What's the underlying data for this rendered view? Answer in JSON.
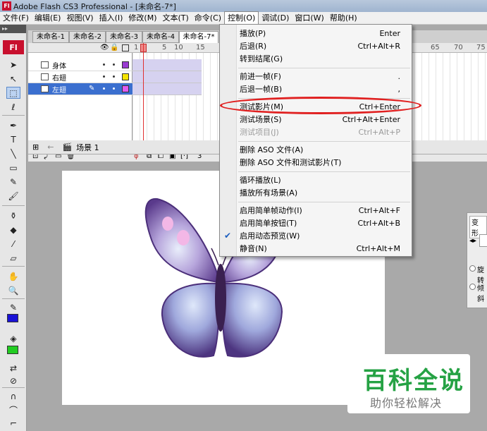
{
  "window": {
    "title": "Adobe Flash CS3 Professional - [未命名-7*]",
    "app_icon": "Fl"
  },
  "menubar": {
    "items": [
      {
        "label": "文件(F)"
      },
      {
        "label": "编辑(E)"
      },
      {
        "label": "视图(V)"
      },
      {
        "label": "插入(I)"
      },
      {
        "label": "修改(M)"
      },
      {
        "label": "文本(T)"
      },
      {
        "label": "命令(C)"
      },
      {
        "label": "控制(O)"
      },
      {
        "label": "调试(D)"
      },
      {
        "label": "窗口(W)"
      },
      {
        "label": "帮助(H)"
      }
    ],
    "active": "控制(O)"
  },
  "toolbox": {
    "logo": "Fl",
    "stroke_color": "#1a12d6",
    "fill_color": "#22cc22"
  },
  "tabs": [
    "未命名-1",
    "未命名-2",
    "未命名-3",
    "未命名-4",
    "未命名-7*"
  ],
  "timeline": {
    "ruler": [
      "1",
      "5",
      "10",
      "15",
      "65",
      "70",
      "75"
    ],
    "layers": [
      {
        "name": "身体",
        "color": "#9a3bd1",
        "selected": false
      },
      {
        "name": "右翅",
        "color": "#f5e400",
        "selected": false
      },
      {
        "name": "左翅",
        "color": "#e05cf0",
        "selected": true
      }
    ],
    "footer_frame": "3"
  },
  "scene": {
    "name": "场景 1"
  },
  "control_menu": {
    "items": [
      {
        "label": "播放(P)",
        "shortcut": "Enter",
        "disabled": false
      },
      {
        "label": "后退(R)",
        "shortcut": "Ctrl+Alt+R",
        "disabled": false
      },
      {
        "label": "转到结尾(G)",
        "shortcut": "",
        "disabled": false
      },
      {
        "label": "前进一帧(F)",
        "shortcut": ".",
        "disabled": false
      },
      {
        "label": "后退一帧(B)",
        "shortcut": ",",
        "disabled": false
      },
      {
        "label": "测试影片(M)",
        "shortcut": "Ctrl+Enter",
        "disabled": false,
        "highlighted": true
      },
      {
        "label": "测试场景(S)",
        "shortcut": "Ctrl+Alt+Enter",
        "disabled": false
      },
      {
        "label": "测试项目(J)",
        "shortcut": "Ctrl+Alt+P",
        "disabled": true
      },
      {
        "label": "删除 ASO 文件(A)",
        "shortcut": "",
        "disabled": false
      },
      {
        "label": "删除 ASO 文件和测试影片(T)",
        "shortcut": "",
        "disabled": false
      },
      {
        "label": "循环播放(L)",
        "shortcut": "",
        "disabled": false
      },
      {
        "label": "播放所有场景(A)",
        "shortcut": "",
        "disabled": false
      },
      {
        "label": "启用简单帧动作(I)",
        "shortcut": "Ctrl+Alt+F",
        "disabled": false
      },
      {
        "label": "启用简单按钮(T)",
        "shortcut": "Ctrl+Alt+B",
        "disabled": false
      },
      {
        "label": "启用动态预览(W)",
        "shortcut": "",
        "disabled": false,
        "checked": true
      },
      {
        "label": "静音(N)",
        "shortcut": "Ctrl+Alt+M",
        "disabled": false
      }
    ]
  },
  "props_panel": {
    "tab": "变形",
    "opt1": "旋转",
    "opt2": "倾斜"
  },
  "watermark": {
    "title": "百科全说",
    "subtitle": "助你轻松解决"
  }
}
